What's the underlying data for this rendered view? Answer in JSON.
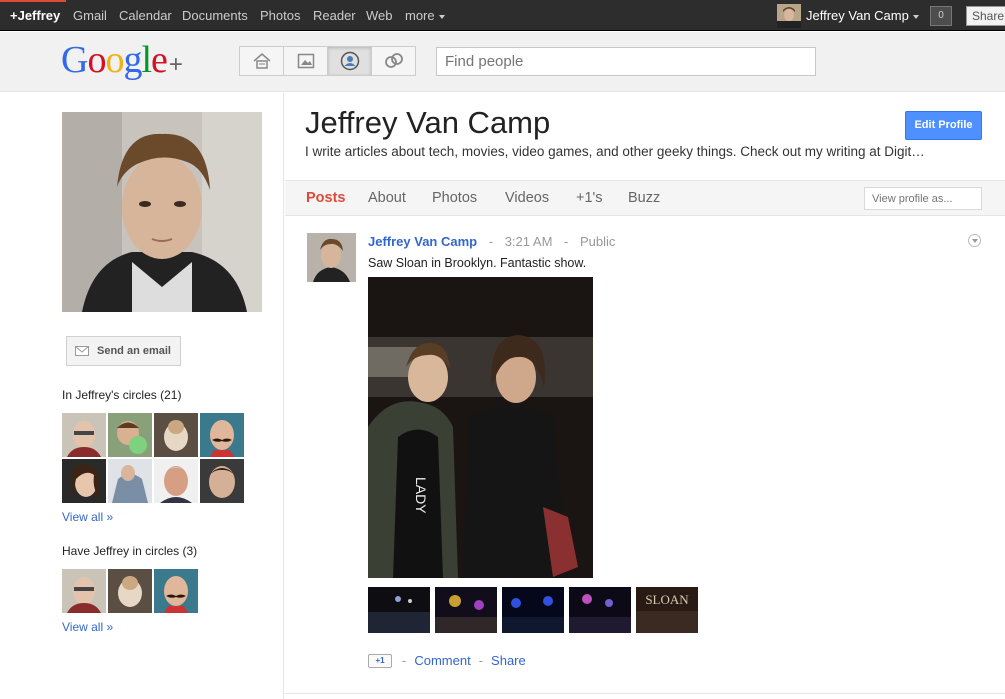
{
  "topbar": {
    "items": [
      "+Jeffrey",
      "Gmail",
      "Calendar",
      "Documents",
      "Photos",
      "Reader",
      "Web",
      "more"
    ],
    "user_name": "Jeffrey Van Camp",
    "notification_count": "0",
    "share_label": "Share"
  },
  "header": {
    "logo_text": "Google",
    "logo_plus": "+",
    "search_placeholder": "Find people",
    "nav_icons": [
      "home-icon",
      "photos-icon",
      "profile-icon",
      "circles-icon"
    ]
  },
  "sidebar": {
    "send_email_label": "Send an email",
    "in_circles_title": "In Jeffrey's circles (21)",
    "have_in_circles_title": "Have Jeffrey in circles (3)",
    "view_all_label": "View all »"
  },
  "profile": {
    "name": "Jeffrey Van Camp",
    "tagline": "I write articles about tech, movies, video games, and other geeky things. Check out my writing at Digit…",
    "edit_profile_label": "Edit Profile",
    "tabs": [
      "Posts",
      "About",
      "Photos",
      "Videos",
      "+1's",
      "Buzz"
    ],
    "view_as_placeholder": "View profile as..."
  },
  "post": {
    "author": "Jeffrey Van Camp",
    "time": "3:21 AM",
    "visibility": "Public",
    "separator": "-",
    "text": "Saw Sloan in Brooklyn. Fantastic show.",
    "plus_one_label": "+1",
    "comment_label": "Comment",
    "share_label": "Share",
    "thumb_last_text": "SLOAN"
  },
  "colors": {
    "accent_red": "#dd4b39",
    "link_blue": "#3366cc",
    "button_blue": "#4d90fe"
  }
}
